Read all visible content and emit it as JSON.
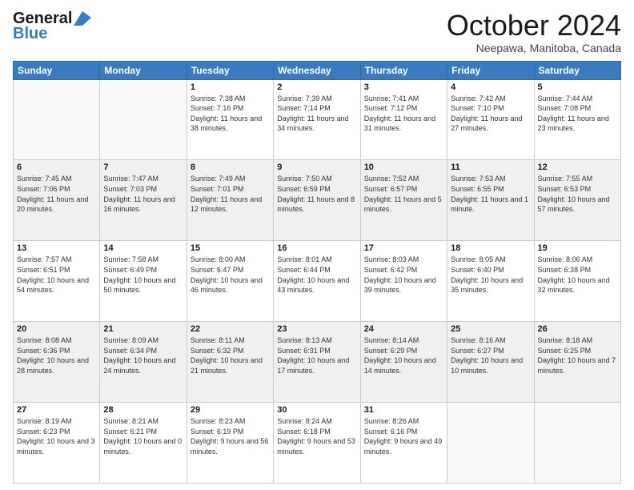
{
  "header": {
    "logo_general": "General",
    "logo_blue": "Blue",
    "month_title": "October 2024",
    "location": "Neepawa, Manitoba, Canada"
  },
  "days_of_week": [
    "Sunday",
    "Monday",
    "Tuesday",
    "Wednesday",
    "Thursday",
    "Friday",
    "Saturday"
  ],
  "weeks": [
    [
      {
        "day": "",
        "info": ""
      },
      {
        "day": "",
        "info": ""
      },
      {
        "day": "1",
        "info": "Sunrise: 7:38 AM\nSunset: 7:16 PM\nDaylight: 11 hours and 38 minutes."
      },
      {
        "day": "2",
        "info": "Sunrise: 7:39 AM\nSunset: 7:14 PM\nDaylight: 11 hours and 34 minutes."
      },
      {
        "day": "3",
        "info": "Sunrise: 7:41 AM\nSunset: 7:12 PM\nDaylight: 11 hours and 31 minutes."
      },
      {
        "day": "4",
        "info": "Sunrise: 7:42 AM\nSunset: 7:10 PM\nDaylight: 11 hours and 27 minutes."
      },
      {
        "day": "5",
        "info": "Sunrise: 7:44 AM\nSunset: 7:08 PM\nDaylight: 11 hours and 23 minutes."
      }
    ],
    [
      {
        "day": "6",
        "info": "Sunrise: 7:45 AM\nSunset: 7:06 PM\nDaylight: 11 hours and 20 minutes."
      },
      {
        "day": "7",
        "info": "Sunrise: 7:47 AM\nSunset: 7:03 PM\nDaylight: 11 hours and 16 minutes."
      },
      {
        "day": "8",
        "info": "Sunrise: 7:49 AM\nSunset: 7:01 PM\nDaylight: 11 hours and 12 minutes."
      },
      {
        "day": "9",
        "info": "Sunrise: 7:50 AM\nSunset: 6:59 PM\nDaylight: 11 hours and 8 minutes."
      },
      {
        "day": "10",
        "info": "Sunrise: 7:52 AM\nSunset: 6:57 PM\nDaylight: 11 hours and 5 minutes."
      },
      {
        "day": "11",
        "info": "Sunrise: 7:53 AM\nSunset: 6:55 PM\nDaylight: 11 hours and 1 minute."
      },
      {
        "day": "12",
        "info": "Sunrise: 7:55 AM\nSunset: 6:53 PM\nDaylight: 10 hours and 57 minutes."
      }
    ],
    [
      {
        "day": "13",
        "info": "Sunrise: 7:57 AM\nSunset: 6:51 PM\nDaylight: 10 hours and 54 minutes."
      },
      {
        "day": "14",
        "info": "Sunrise: 7:58 AM\nSunset: 6:49 PM\nDaylight: 10 hours and 50 minutes."
      },
      {
        "day": "15",
        "info": "Sunrise: 8:00 AM\nSunset: 6:47 PM\nDaylight: 10 hours and 46 minutes."
      },
      {
        "day": "16",
        "info": "Sunrise: 8:01 AM\nSunset: 6:44 PM\nDaylight: 10 hours and 43 minutes."
      },
      {
        "day": "17",
        "info": "Sunrise: 8:03 AM\nSunset: 6:42 PM\nDaylight: 10 hours and 39 minutes."
      },
      {
        "day": "18",
        "info": "Sunrise: 8:05 AM\nSunset: 6:40 PM\nDaylight: 10 hours and 35 minutes."
      },
      {
        "day": "19",
        "info": "Sunrise: 8:06 AM\nSunset: 6:38 PM\nDaylight: 10 hours and 32 minutes."
      }
    ],
    [
      {
        "day": "20",
        "info": "Sunrise: 8:08 AM\nSunset: 6:36 PM\nDaylight: 10 hours and 28 minutes."
      },
      {
        "day": "21",
        "info": "Sunrise: 8:09 AM\nSunset: 6:34 PM\nDaylight: 10 hours and 24 minutes."
      },
      {
        "day": "22",
        "info": "Sunrise: 8:11 AM\nSunset: 6:32 PM\nDaylight: 10 hours and 21 minutes."
      },
      {
        "day": "23",
        "info": "Sunrise: 8:13 AM\nSunset: 6:31 PM\nDaylight: 10 hours and 17 minutes."
      },
      {
        "day": "24",
        "info": "Sunrise: 8:14 AM\nSunset: 6:29 PM\nDaylight: 10 hours and 14 minutes."
      },
      {
        "day": "25",
        "info": "Sunrise: 8:16 AM\nSunset: 6:27 PM\nDaylight: 10 hours and 10 minutes."
      },
      {
        "day": "26",
        "info": "Sunrise: 8:18 AM\nSunset: 6:25 PM\nDaylight: 10 hours and 7 minutes."
      }
    ],
    [
      {
        "day": "27",
        "info": "Sunrise: 8:19 AM\nSunset: 6:23 PM\nDaylight: 10 hours and 3 minutes."
      },
      {
        "day": "28",
        "info": "Sunrise: 8:21 AM\nSunset: 6:21 PM\nDaylight: 10 hours and 0 minutes."
      },
      {
        "day": "29",
        "info": "Sunrise: 8:23 AM\nSunset: 6:19 PM\nDaylight: 9 hours and 56 minutes."
      },
      {
        "day": "30",
        "info": "Sunrise: 8:24 AM\nSunset: 6:18 PM\nDaylight: 9 hours and 53 minutes."
      },
      {
        "day": "31",
        "info": "Sunrise: 8:26 AM\nSunset: 6:16 PM\nDaylight: 9 hours and 49 minutes."
      },
      {
        "day": "",
        "info": ""
      },
      {
        "day": "",
        "info": ""
      }
    ]
  ]
}
